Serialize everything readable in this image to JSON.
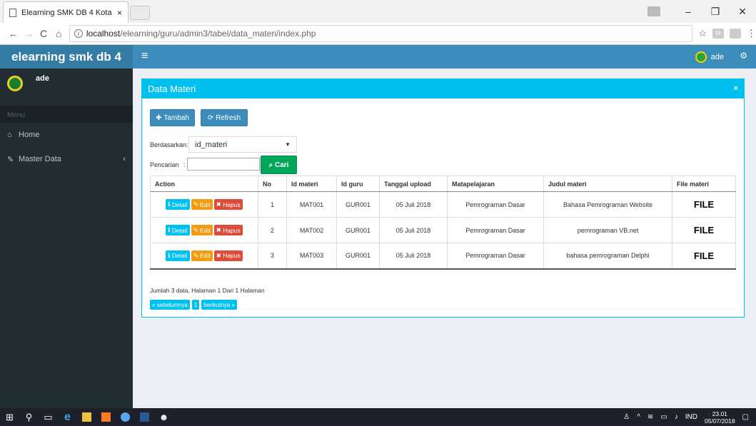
{
  "browser": {
    "tab_title": "Elearning SMK DB 4 Kota",
    "tab_close": "×",
    "url_host": "localhost",
    "url_path": "/elearning/guru/admin3/tabel/data_materi/index.php",
    "win_minimize": "–",
    "win_restore": "❐",
    "win_close": "✕"
  },
  "app": {
    "brand": "elearning smk db 4",
    "menu_toggle": "≡",
    "username": "ade"
  },
  "sidebar": {
    "user_name": "ade",
    "menu_header": "Menu",
    "items": [
      {
        "label": "Home",
        "icon": "home-icon"
      },
      {
        "label": "Master Data",
        "icon": "edit-icon",
        "chevron": "‹"
      }
    ]
  },
  "panel": {
    "title": "Data Materi",
    "close": "×",
    "btn_tambah": "Tambah",
    "btn_refresh": "Refresh",
    "label_berdasarkan": "Berdasarkan:",
    "select_value": "id_materi",
    "label_pencarian": "Pencarian",
    "label_pencarian_colon": ":",
    "search_value": "",
    "btn_cari": "Cari"
  },
  "table": {
    "headers": [
      "Action",
      "No",
      "Id materi",
      "Id guru",
      "Tanggal upload",
      "Matapelajaran",
      "Judul materi",
      "File materi"
    ],
    "action_labels": {
      "detail": "Detail",
      "edit": "Edit",
      "hapus": "Hapus"
    },
    "rows": [
      {
        "no": "1",
        "id_materi": "MAT001",
        "id_guru": "GUR001",
        "tanggal": "05 Juli 2018",
        "mapel": "Pemrograman Dasar",
        "judul": "Bahasa Pemrograman Website",
        "file": "FILE"
      },
      {
        "no": "2",
        "id_materi": "MAT002",
        "id_guru": "GUR001",
        "tanggal": "05 Juli 2018",
        "mapel": "Pemrograman Dasar",
        "judul": "pemrograman VB.net",
        "file": "FILE"
      },
      {
        "no": "3",
        "id_materi": "MAT003",
        "id_guru": "GUR001",
        "tanggal": "05 Juli 2018",
        "mapel": "Pemrograman Dasar",
        "judul": "bahasa pemrograman Delphi",
        "file": "FILE"
      }
    ]
  },
  "pagination": {
    "summary": "Jumlah 3 data, Halaman 1 Dari 1 Halaman",
    "prev": "« sebelumnya",
    "current": "1",
    "next": "berikutnya »"
  },
  "taskbar": {
    "lang": "IND",
    "time": "23.01",
    "date": "05/07/2018"
  },
  "colors": {
    "primary": "#3c8dbc",
    "info": "#00c0ef",
    "success": "#00a65a",
    "warning": "#f39c12",
    "danger": "#dd4b39",
    "sidebar": "#222d32"
  }
}
